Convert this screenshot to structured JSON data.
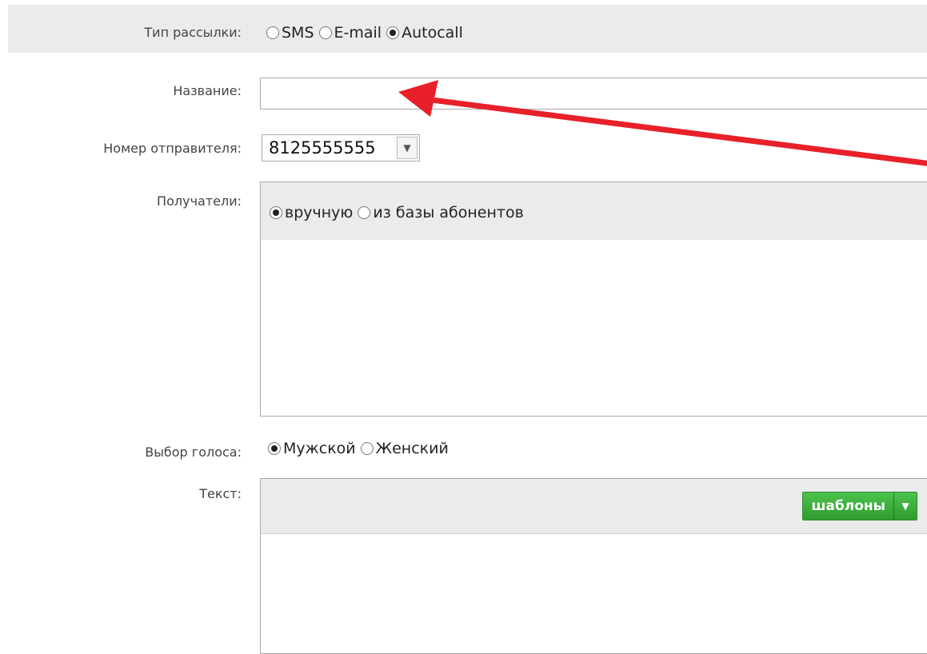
{
  "form": {
    "type_label": "Тип рассылки:",
    "type_options": [
      {
        "label": "SMS",
        "checked": false
      },
      {
        "label": "E-mail",
        "checked": false
      },
      {
        "label": "Autocall",
        "checked": true
      }
    ],
    "name_label": "Название:",
    "name_value": "",
    "sender_label": "Номер отправителя:",
    "sender_value": "8125555555",
    "recipients_label": "Получатели:",
    "recipients_options": [
      {
        "label": "вручную",
        "checked": true
      },
      {
        "label": "из базы абонентов",
        "checked": false
      }
    ],
    "voice_label": "Выбор голоса:",
    "voice_options": [
      {
        "label": "Мужской",
        "checked": true
      },
      {
        "label": "Женский",
        "checked": false
      }
    ],
    "text_label": "Текст:",
    "templates_button": "шаблоны"
  },
  "colors": {
    "accent_orange": "#f07c1b",
    "annotation_red": "#e8202a",
    "button_green": "#3aae3a",
    "band_gray": "#ebebeb"
  }
}
